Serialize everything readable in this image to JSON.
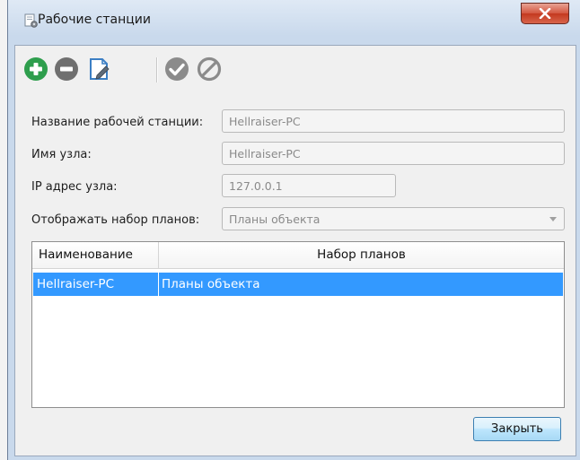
{
  "window": {
    "title": "Рабочие станции"
  },
  "toolbar": {
    "buttons": [
      {
        "name": "add-icon",
        "color": "#2e9e4d"
      },
      {
        "name": "remove-icon",
        "color": "#6f6f6f"
      },
      {
        "name": "edit-icon",
        "color": "#3c7fc4"
      },
      {
        "name": "apply-icon",
        "color": "#8b8b8b"
      },
      {
        "name": "cancel-icon",
        "color": "#8b8b8b"
      }
    ]
  },
  "form": {
    "station_name": {
      "label": "Название рабочей станции:",
      "value": "Hellraiser-PC"
    },
    "host_name": {
      "label": "Имя узла:",
      "value": "Hellraiser-PC"
    },
    "ip": {
      "label": "IP адрес узла:",
      "value": "127.0.0.1"
    },
    "plan_set": {
      "label": "Отображать набор планов:",
      "value": "Планы объекта"
    }
  },
  "table": {
    "columns": [
      "Наименование",
      "Набор планов"
    ],
    "rows": [
      {
        "name": "Hellraiser-PC",
        "plan_set": "Планы объекта"
      }
    ]
  },
  "buttons": {
    "close": "Закрыть"
  },
  "colors": {
    "selection": "#3399ff",
    "close_button": "#c3391f"
  }
}
